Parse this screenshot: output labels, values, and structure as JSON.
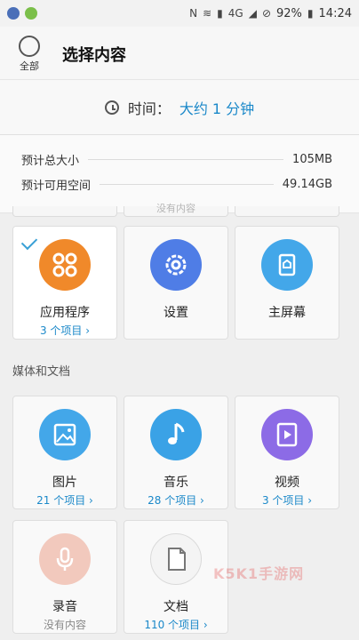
{
  "status_bar": {
    "battery": "92%",
    "time": "14:24",
    "network": "4G"
  },
  "header": {
    "select_all_label": "全部",
    "title": "选择内容"
  },
  "time_estimate": {
    "label": "时间：",
    "value": "大约 1 分钟"
  },
  "sizes": {
    "estimated_total_label": "预计总大小",
    "estimated_total_value": "105MB",
    "available_label": "预计可用空间",
    "available_value": "49.14GB"
  },
  "top_row_stub_text": "没有内容",
  "apps_section": {
    "items": [
      {
        "name": "应用程序",
        "count": "3 个项目 ›",
        "icon": "apps-icon",
        "color": "#f0892a"
      },
      {
        "name": "设置",
        "count": "",
        "icon": "gear-icon",
        "color": "#4f7de6"
      },
      {
        "name": "主屏幕",
        "count": "",
        "icon": "home-screen-icon",
        "color": "#43a7e9"
      }
    ]
  },
  "media_section": {
    "title": "媒体和文档",
    "items": [
      {
        "name": "图片",
        "count": "21 个项目 ›",
        "icon": "image-icon",
        "color": "#43a7e9"
      },
      {
        "name": "音乐",
        "count": "28 个项目 ›",
        "icon": "music-icon",
        "color": "#3aa2e6"
      },
      {
        "name": "视频",
        "count": "3 个项目 ›",
        "icon": "video-icon",
        "color": "#8c6be6"
      },
      {
        "name": "录音",
        "count": "没有内容",
        "icon": "microphone-icon",
        "color": "#f2c9bd"
      },
      {
        "name": "文档",
        "count": "110 个项目 ›",
        "icon": "document-icon",
        "color": "#f4f4f4"
      }
    ]
  },
  "watermark": "K5K1手游网"
}
